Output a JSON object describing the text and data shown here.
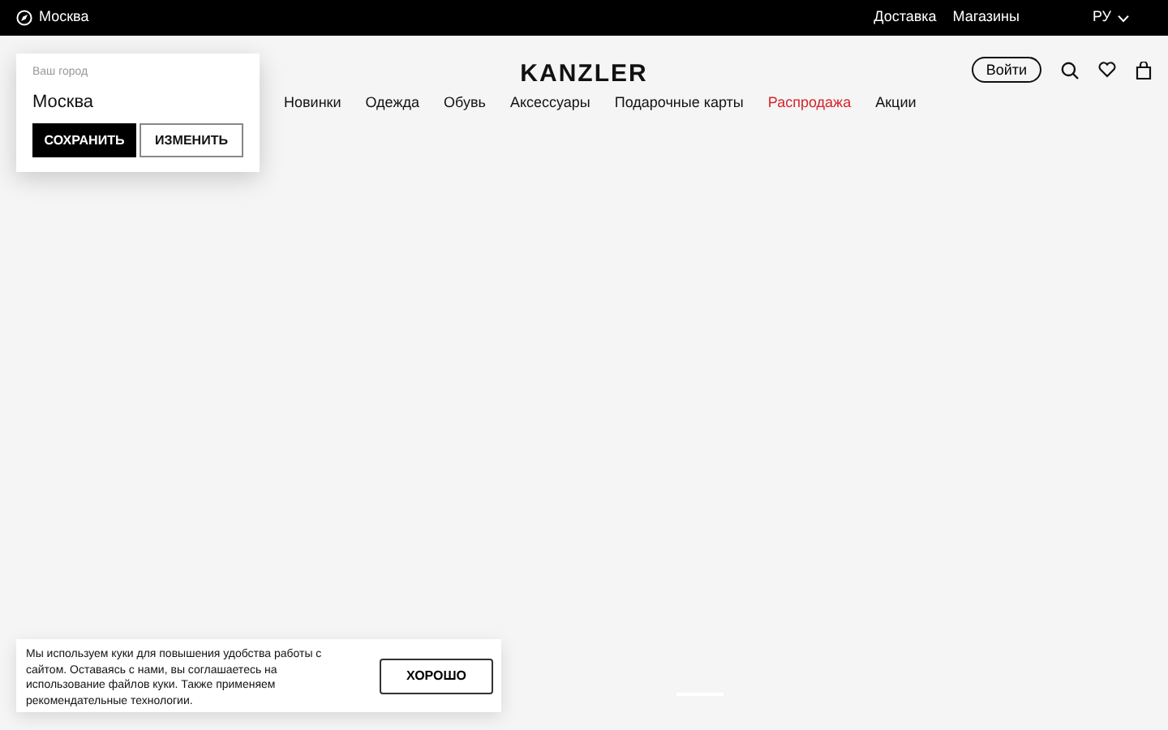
{
  "top_bar": {
    "city": "Москва",
    "links": [
      "Доставка",
      "Магазины"
    ],
    "language": "РУ"
  },
  "header": {
    "logo": "KANZLER",
    "login": "Войти"
  },
  "nav": [
    {
      "label": "Новинки",
      "color": "#111111"
    },
    {
      "label": "Одежда",
      "color": "#111111"
    },
    {
      "label": "Обувь",
      "color": "#111111"
    },
    {
      "label": "Аксессуары",
      "color": "#111111"
    },
    {
      "label": "Подарочные карты",
      "color": "#111111"
    },
    {
      "label": "Распродажа",
      "color": "#d3262b"
    },
    {
      "label": "Акции",
      "color": "#111111"
    }
  ],
  "city_popup": {
    "caption": "Ваш город",
    "city": "Москва",
    "buttons": [
      {
        "label": "СОХРАНИТЬ",
        "kind": "primary"
      },
      {
        "label": "ИЗМЕНИТЬ",
        "kind": "outline"
      }
    ]
  },
  "cookie_banner": {
    "parts": [
      {
        "kind": "text",
        "text": "Мы используем куки для повышения удобства работы с сайтом. Оставаясь с нами, вы соглашаетесь на использование "
      },
      {
        "kind": "link",
        "text": "файлов куки"
      },
      {
        "kind": "text",
        "text": ". Также применяем "
      },
      {
        "kind": "link",
        "text": "рекомендательные технологии"
      },
      {
        "kind": "text",
        "text": "."
      }
    ],
    "button": "ХОРОШО"
  }
}
